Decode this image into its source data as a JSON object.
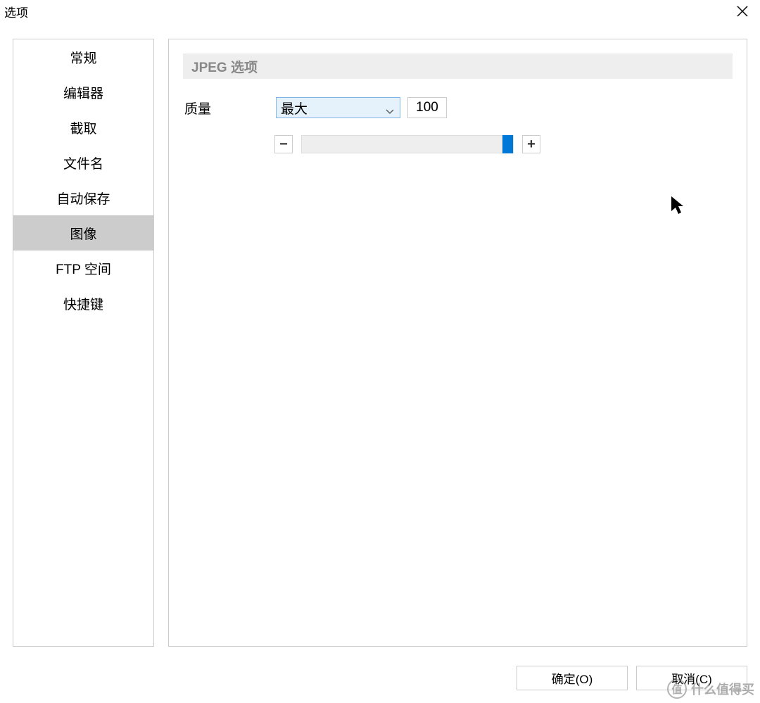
{
  "window": {
    "title": "选项"
  },
  "sidebar": {
    "items": [
      {
        "label": "常规"
      },
      {
        "label": "编辑器"
      },
      {
        "label": "截取"
      },
      {
        "label": "文件名"
      },
      {
        "label": "自动保存"
      },
      {
        "label": "图像"
      },
      {
        "label": "FTP 空间"
      },
      {
        "label": "快捷键"
      }
    ],
    "selected_index": 5
  },
  "panel": {
    "section_title": "JPEG 选项",
    "quality_label": "质量",
    "quality_select_value": "最大",
    "quality_numeric_value": "100",
    "minus_label": "−",
    "plus_label": "+",
    "slider_percent": 100
  },
  "footer": {
    "ok_label": "确定(O)",
    "cancel_label": "取消(C)"
  },
  "watermark": {
    "badge": "值",
    "text": "什么值得买"
  }
}
